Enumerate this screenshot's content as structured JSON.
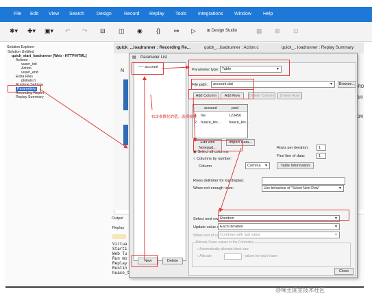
{
  "menubar": {
    "items": [
      "File",
      "Edit",
      "View",
      "Search",
      "Design",
      "Record",
      "Replay",
      "Tools",
      "Integrations",
      "Window",
      "Help"
    ],
    "background": "#1e78d7"
  },
  "toolbar": {
    "design_studio": "Design Studio"
  },
  "explorer": {
    "title": "Solution Explorer",
    "items": [
      "Solution Untitled",
      "quick_start_loadrunner [Web - HTTP/HTML]",
      "Actions",
      "vuser_init",
      "Action",
      "vuser_end",
      "Extra Files",
      "globals.h",
      "Runtime Settings",
      "Parameters",
      "Recording Report",
      "Replay Summary"
    ]
  },
  "tabs": [
    "quick_...loadrunner : Recording Re...",
    "quick_...loadrunner : Action.c",
    "quick_...loadrunner : Replay Summary"
  ],
  "editor": {
    "texts": [
      "N",
      "C",
      "e",
      "ORD",
      "23/0",
      "/23/0"
    ]
  },
  "output": {
    "title": "Output",
    "tab": "Replay",
    "lines": [
      "Virtua",
      "Starti",
      "Web Tu",
      "Run mo",
      "Replay",
      "Runtin",
      "huace_tester"
    ]
  },
  "dialog": {
    "title": "Parameter List",
    "param_item": "account",
    "new_label": "New",
    "delete_label": "Delete",
    "param_type_label": "Parameter type:",
    "param_type_value": "Table",
    "file_path_label": "File path:",
    "file_path_value": "account.dat",
    "browse_label": "Browse...",
    "add_column": "Add Column",
    "add_row": "Add Row",
    "delete_column": "Delete Column",
    "delete_row": "Delete Row",
    "table": {
      "headers": [
        "account",
        "pwd"
      ],
      "rows": [
        [
          "1",
          "hw",
          "123456"
        ],
        [
          "2",
          "huace_tes...",
          "huace_tes..."
        ]
      ]
    },
    "edit_notepad": "Edit with Notepad...",
    "import_db": "Import Data...",
    "select_all_columns": "Select all columns",
    "columns_by_number": "Columns by number:",
    "column_label": "Column",
    "delimiter_label": "Comma",
    "rows_per_iteration_label": "Rows per iteration:",
    "rows_per_iteration_value": "1",
    "first_line_label": "First line of data:",
    "first_line_value": "1",
    "table_information": "Table Information",
    "rows_delimiter_label": "Rows delimiter for log display:",
    "not_enough_rows_label": "When not enough rows:",
    "not_enough_rows_value": "Use behaviour of \"Select Next Row\"",
    "select_next_row_label": "Select next row:",
    "select_next_row_value": "Random",
    "update_value_label": "Update value on:",
    "update_value_value": "Each iteration",
    "out_of_values_label": "When out of values:",
    "out_of_values_value": "Continue with last value",
    "allocate_label": "Allocate Vuser values in the Controller",
    "auto_allocate": "Automatically allocate block size",
    "allocate_values": "Allocate",
    "values_for_each": "values for each Vuser",
    "close_label": "Close",
    "annotation": "右击参数化的值，选择参数"
  },
  "watermark": "@稀土掘金技术社区",
  "colors": {
    "red": "#e13a3a",
    "blue": "#2c6fd1"
  }
}
